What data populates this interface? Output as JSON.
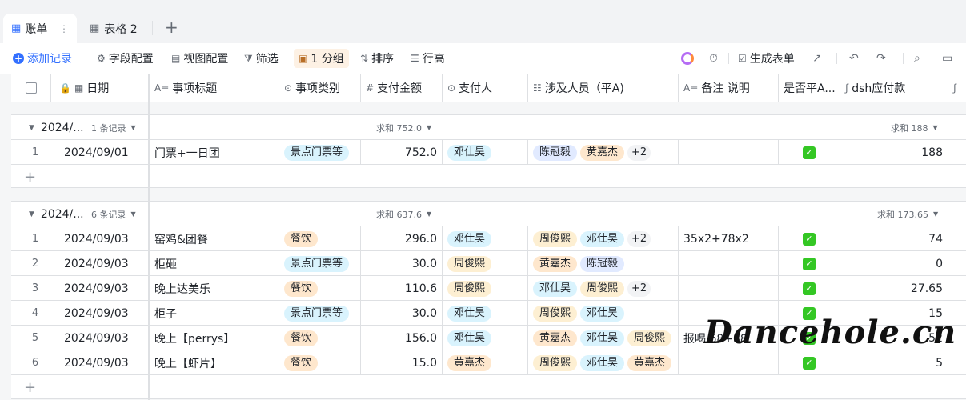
{
  "tabs": [
    {
      "label": "账单",
      "active": true
    },
    {
      "label": "表格 2",
      "active": false
    }
  ],
  "toolbar": {
    "add_record": "添加记录",
    "field_config": "字段配置",
    "view_config": "视图配置",
    "filter": "筛选",
    "group": "1 分组",
    "sort": "排序",
    "row_height": "行高",
    "generate_form": "生成表单"
  },
  "columns": [
    "日期",
    "事项标题",
    "事项类别",
    "支付金额",
    "支付人",
    "涉及人员（平A)",
    "备注 说明",
    "是否平A...",
    "dsh应付款"
  ],
  "groups": [
    {
      "title": "2024/...",
      "count": "1 条记录",
      "sum_amount": "求和 752.0",
      "sum_due": "求和 188",
      "rows": [
        {
          "idx": "1",
          "date": "2024/09/01",
          "title": "门票+一日团",
          "category": "景点门票等",
          "amount": "752.0",
          "payer": "邓仕昊",
          "people": [
            "陈冠毅",
            "黄嘉杰"
          ],
          "more": "+2",
          "note": "",
          "due": "188"
        }
      ]
    },
    {
      "title": "2024/...",
      "count": "6 条记录",
      "sum_amount": "求和 637.6",
      "sum_due": "求和 173.65",
      "rows": [
        {
          "idx": "1",
          "date": "2024/09/03",
          "title": "窑鸡&团餐",
          "category": "餐饮",
          "amount": "296.0",
          "payer": "邓仕昊",
          "people": [
            "周俊熙",
            "邓仕昊"
          ],
          "more": "+2",
          "note": "35x2+78x2",
          "due": "74"
        },
        {
          "idx": "2",
          "date": "2024/09/03",
          "title": "柜砸",
          "category": "景点门票等",
          "amount": "30.0",
          "payer": "周俊熙",
          "people": [
            "黄嘉杰",
            "陈冠毅"
          ],
          "more": "",
          "note": "",
          "due": "0"
        },
        {
          "idx": "3",
          "date": "2024/09/03",
          "title": "晚上达美乐",
          "category": "餐饮",
          "amount": "110.6",
          "payer": "周俊熙",
          "people": [
            "邓仕昊",
            "周俊熙"
          ],
          "more": "+2",
          "note": "",
          "due": "27.65"
        },
        {
          "idx": "4",
          "date": "2024/09/03",
          "title": "柜子",
          "category": "景点门票等",
          "amount": "30.0",
          "payer": "邓仕昊",
          "people": [
            "周俊熙",
            "邓仕昊"
          ],
          "more": "",
          "note": "",
          "due": "15"
        },
        {
          "idx": "5",
          "date": "2024/09/03",
          "title": "晚上【perrys】",
          "category": "餐饮",
          "amount": "156.0",
          "payer": "邓仕昊",
          "people": [
            "黄嘉杰",
            "邓仕昊",
            "周俊熙"
          ],
          "more": "",
          "note": "报喝 68+88",
          "due": "52"
        },
        {
          "idx": "6",
          "date": "2024/09/03",
          "title": "晚上【虾片】",
          "category": "餐饮",
          "amount": "15.0",
          "payer": "黄嘉杰",
          "people": [
            "周俊熙",
            "邓仕昊",
            "黄嘉杰"
          ],
          "more": "",
          "note": "",
          "due": "5"
        }
      ]
    }
  ],
  "watermark": "Dancehole.cn",
  "colors": {
    "accent": "#3370ff",
    "checkbox": "#34c724",
    "tag_blue": "#d9f3fd",
    "tag_orange": "#fee7cd"
  }
}
